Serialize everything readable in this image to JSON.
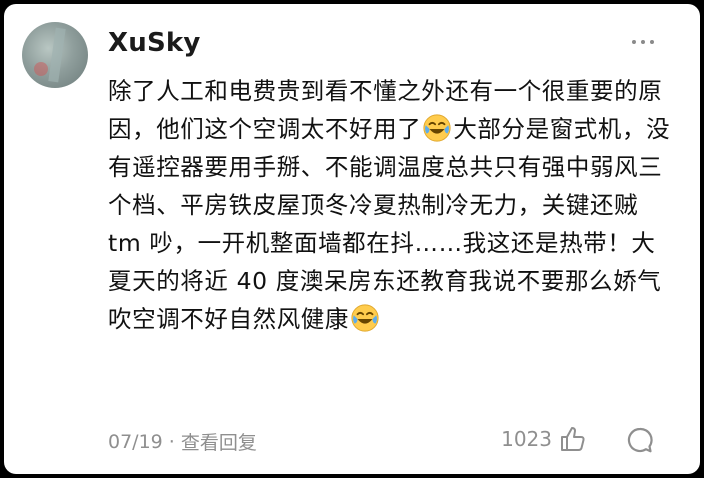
{
  "comment": {
    "username": "XuSky",
    "text_parts": [
      "除了人工和电费贵到看不懂之外还有一个很重要的原因，他们这个空调太不好用了",
      "大部分是窗式机，没有遥控器要用手掰、不能调温度总共只有强中弱风三个档、平房铁皮屋顶冬冷夏热制冷无力，关键还贼 tm 吵，一开机整面墙都在抖……我这还是热带！大夏天的将近 40 度澳呆房东还教育我说不要那么娇气吹空调不好自然风健康"
    ],
    "date": "07/19",
    "separator": "·",
    "view_replies": "查看回复",
    "like_count": "1023"
  },
  "icons": {
    "emoji": "laughing-crying-emoji",
    "more": "more-dots-icon",
    "like": "thumbs-up-icon",
    "comment": "comment-bubble-icon"
  }
}
